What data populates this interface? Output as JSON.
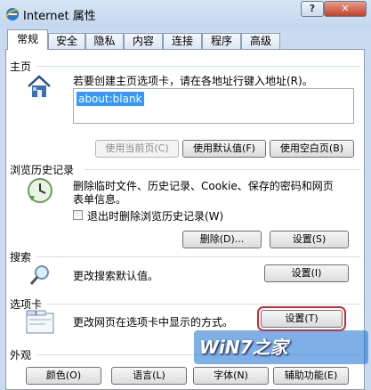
{
  "window": {
    "title": "Internet 属性",
    "help_label": "?",
    "close_label": "✕"
  },
  "tabs": [
    {
      "label": "常规"
    },
    {
      "label": "安全"
    },
    {
      "label": "隐私"
    },
    {
      "label": "内容"
    },
    {
      "label": "连接"
    },
    {
      "label": "程序"
    },
    {
      "label": "高级"
    }
  ],
  "home": {
    "title": "主页",
    "description": "若要创建主页选项卡，请在各地址行键入地址(R)。",
    "address": "about:blank",
    "use_current_label": "使用当前页(C)",
    "use_default_label": "使用默认值(F)",
    "use_blank_label": "使用空白页(B)"
  },
  "history": {
    "title": "浏览历史记录",
    "description_line1": "删除临时文件、历史记录、Cookie、保存的密码和网页",
    "description_line2": "表单信息。",
    "checkbox_label": "退出时删除浏览历史记录(W)",
    "checkbox_checked": false,
    "delete_label": "删除(D)...",
    "settings_label": "设置(S)"
  },
  "search": {
    "title": "搜索",
    "description": "更改搜索默认值。",
    "settings_label": "设置(I)"
  },
  "tabs_section": {
    "title": "选项卡",
    "description": "更改网页在选项卡中显示的方式。",
    "settings_label": "设置(T)"
  },
  "appearance": {
    "title": "外观",
    "colors_label": "颜色(O)",
    "languages_label": "语言(L)",
    "fonts_label": "字体(N)",
    "accessibility_label": "辅助功能(E)"
  },
  "watermark": {
    "text": "WiN7之家"
  },
  "colors": {
    "selection": "#3399ff",
    "highlight_box": "#d22a2a"
  }
}
